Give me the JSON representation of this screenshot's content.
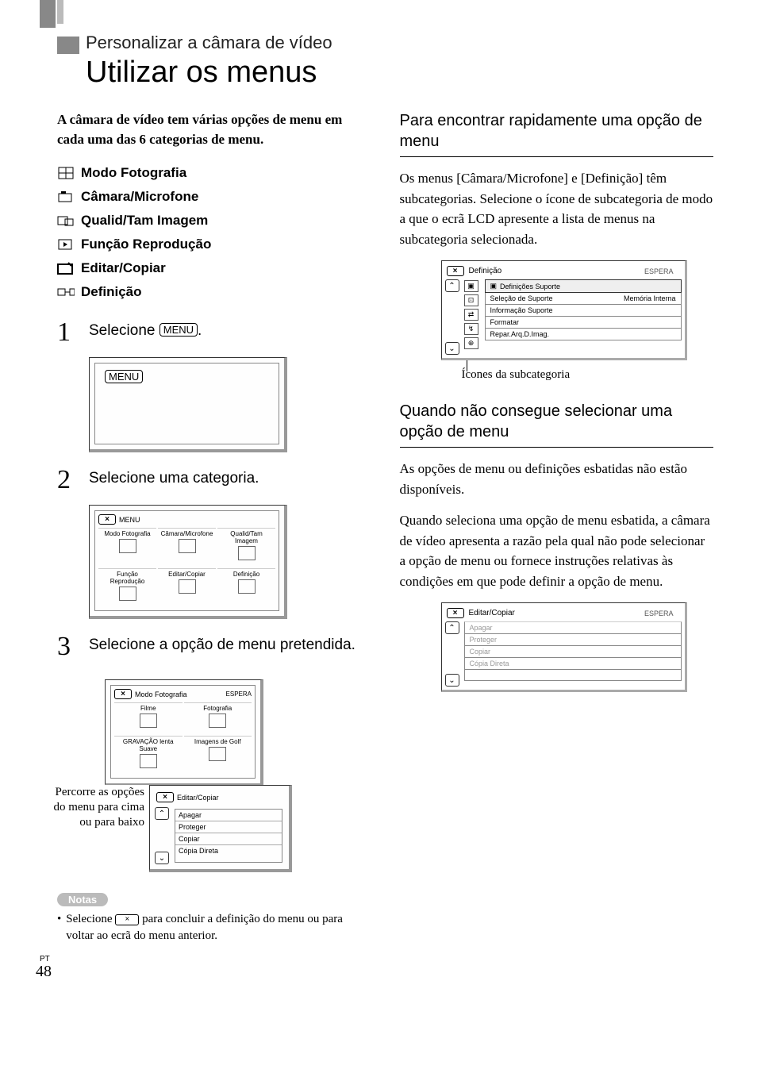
{
  "section_title": "Personalizar a câmara de vídeo",
  "main_title": "Utilizar os menus",
  "intro": "A câmara de vídeo tem várias opções de menu em cada uma das 6 categorias de menu.",
  "categories": [
    {
      "label": "Modo Fotografia"
    },
    {
      "label": "Câmara/Microfone"
    },
    {
      "label": "Qualid/Tam Imagem"
    },
    {
      "label": "Função Reprodução"
    },
    {
      "label": "Editar/Copiar"
    },
    {
      "label": "Definição"
    }
  ],
  "steps": {
    "s1": {
      "num": "1",
      "text_pre": "Selecione ",
      "menu_label": "MENU",
      "text_post": "."
    },
    "s2": {
      "num": "2",
      "text": "Selecione uma categoria."
    },
    "s3": {
      "num": "3",
      "text": "Selecione a opção de menu pretendida."
    }
  },
  "illus_menu_only": {
    "menu_label": "MENU"
  },
  "illus_categories": {
    "close": "×",
    "menu_label": "MENU",
    "tiles": [
      "Modo Fotografia",
      "Câmara/Microfone",
      "Qualid/Tam Imagem",
      "Função Reprodução",
      "Editar/Copiar",
      "Definição"
    ]
  },
  "illus_modo": {
    "close": "×",
    "title": "Modo Fotografia",
    "status": "ESPERA",
    "tiles": [
      "Filme",
      "Fotografia",
      "GRAVAÇÃO lenta Suave",
      "Imagens de Golf"
    ]
  },
  "illus_editar": {
    "close": "×",
    "title": "Editar/Copiar",
    "rows": [
      "Apagar",
      "Proteger",
      "Copiar",
      "Cópia Direta"
    ]
  },
  "scroll_note": "Percorre as opções do menu para cima ou para baixo",
  "notes_label": "Notas",
  "note_bullet_pre": "Selecione ",
  "note_bullet_post": " para concluir a definição do menu ou para voltar ao ecrã do menu anterior.",
  "close_glyph": "×",
  "right": {
    "h1": "Para encontrar rapidamente uma opção de menu",
    "p1": "Os menus [Câmara/Microfone] e [Definição] têm subcategorias. Selecione o ícone de subcategoria de modo a que o ecrã LCD apresente a lista de menus na subcategoria selecionada.",
    "illus_def": {
      "close": "×",
      "title": "Definição",
      "status": "ESPERA",
      "header": "Definições Suporte",
      "rows": [
        {
          "l": "Seleção de Suporte",
          "r": "Memória Interna"
        },
        {
          "l": "Informação Suporte",
          "r": ""
        },
        {
          "l": "Formatar",
          "r": ""
        },
        {
          "l": "Repar.Arq.D.Imag.",
          "r": ""
        }
      ]
    },
    "caption": "Ícones da subcategoria",
    "h2": "Quando não consegue selecionar uma opção de menu",
    "p2": "As opções de menu ou definições esbatidas não estão disponíveis.",
    "p3": "Quando seleciona uma opção de menu esbatida, a câmara de vídeo apresenta a razão pela qual não pode selecionar a opção de menu ou fornece instruções relativas às condições em que pode definir a opção de menu.",
    "illus_gray": {
      "close": "×",
      "title": "Editar/Copiar",
      "status": "ESPERA",
      "rows": [
        "Apagar",
        "Proteger",
        "Copiar",
        "Cópia Direta"
      ]
    }
  },
  "page_lang": "PT",
  "page_number": "48"
}
